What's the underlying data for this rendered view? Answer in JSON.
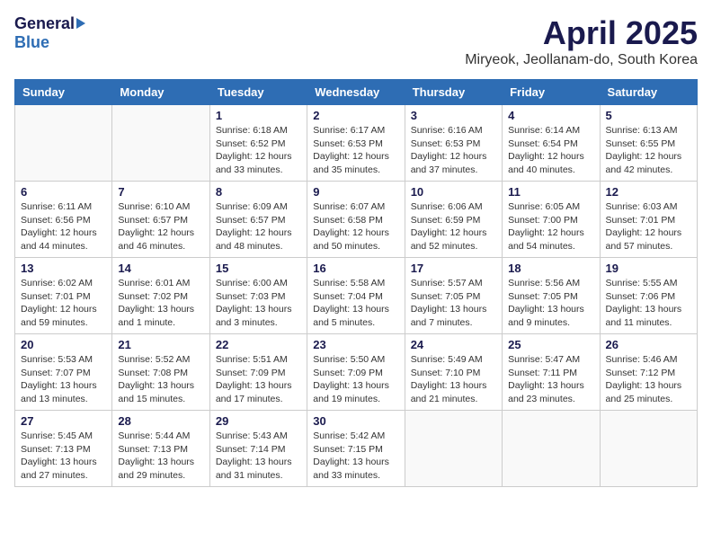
{
  "header": {
    "logo_general": "General",
    "logo_blue": "Blue",
    "title": "April 2025",
    "location": "Miryeok, Jeollanam-do, South Korea"
  },
  "days_of_week": [
    "Sunday",
    "Monday",
    "Tuesday",
    "Wednesday",
    "Thursday",
    "Friday",
    "Saturday"
  ],
  "weeks": [
    [
      {
        "day": "",
        "info": ""
      },
      {
        "day": "",
        "info": ""
      },
      {
        "day": "1",
        "info": "Sunrise: 6:18 AM\nSunset: 6:52 PM\nDaylight: 12 hours\nand 33 minutes."
      },
      {
        "day": "2",
        "info": "Sunrise: 6:17 AM\nSunset: 6:53 PM\nDaylight: 12 hours\nand 35 minutes."
      },
      {
        "day": "3",
        "info": "Sunrise: 6:16 AM\nSunset: 6:53 PM\nDaylight: 12 hours\nand 37 minutes."
      },
      {
        "day": "4",
        "info": "Sunrise: 6:14 AM\nSunset: 6:54 PM\nDaylight: 12 hours\nand 40 minutes."
      },
      {
        "day": "5",
        "info": "Sunrise: 6:13 AM\nSunset: 6:55 PM\nDaylight: 12 hours\nand 42 minutes."
      }
    ],
    [
      {
        "day": "6",
        "info": "Sunrise: 6:11 AM\nSunset: 6:56 PM\nDaylight: 12 hours\nand 44 minutes."
      },
      {
        "day": "7",
        "info": "Sunrise: 6:10 AM\nSunset: 6:57 PM\nDaylight: 12 hours\nand 46 minutes."
      },
      {
        "day": "8",
        "info": "Sunrise: 6:09 AM\nSunset: 6:57 PM\nDaylight: 12 hours\nand 48 minutes."
      },
      {
        "day": "9",
        "info": "Sunrise: 6:07 AM\nSunset: 6:58 PM\nDaylight: 12 hours\nand 50 minutes."
      },
      {
        "day": "10",
        "info": "Sunrise: 6:06 AM\nSunset: 6:59 PM\nDaylight: 12 hours\nand 52 minutes."
      },
      {
        "day": "11",
        "info": "Sunrise: 6:05 AM\nSunset: 7:00 PM\nDaylight: 12 hours\nand 54 minutes."
      },
      {
        "day": "12",
        "info": "Sunrise: 6:03 AM\nSunset: 7:01 PM\nDaylight: 12 hours\nand 57 minutes."
      }
    ],
    [
      {
        "day": "13",
        "info": "Sunrise: 6:02 AM\nSunset: 7:01 PM\nDaylight: 12 hours\nand 59 minutes."
      },
      {
        "day": "14",
        "info": "Sunrise: 6:01 AM\nSunset: 7:02 PM\nDaylight: 13 hours\nand 1 minute."
      },
      {
        "day": "15",
        "info": "Sunrise: 6:00 AM\nSunset: 7:03 PM\nDaylight: 13 hours\nand 3 minutes."
      },
      {
        "day": "16",
        "info": "Sunrise: 5:58 AM\nSunset: 7:04 PM\nDaylight: 13 hours\nand 5 minutes."
      },
      {
        "day": "17",
        "info": "Sunrise: 5:57 AM\nSunset: 7:05 PM\nDaylight: 13 hours\nand 7 minutes."
      },
      {
        "day": "18",
        "info": "Sunrise: 5:56 AM\nSunset: 7:05 PM\nDaylight: 13 hours\nand 9 minutes."
      },
      {
        "day": "19",
        "info": "Sunrise: 5:55 AM\nSunset: 7:06 PM\nDaylight: 13 hours\nand 11 minutes."
      }
    ],
    [
      {
        "day": "20",
        "info": "Sunrise: 5:53 AM\nSunset: 7:07 PM\nDaylight: 13 hours\nand 13 minutes."
      },
      {
        "day": "21",
        "info": "Sunrise: 5:52 AM\nSunset: 7:08 PM\nDaylight: 13 hours\nand 15 minutes."
      },
      {
        "day": "22",
        "info": "Sunrise: 5:51 AM\nSunset: 7:09 PM\nDaylight: 13 hours\nand 17 minutes."
      },
      {
        "day": "23",
        "info": "Sunrise: 5:50 AM\nSunset: 7:09 PM\nDaylight: 13 hours\nand 19 minutes."
      },
      {
        "day": "24",
        "info": "Sunrise: 5:49 AM\nSunset: 7:10 PM\nDaylight: 13 hours\nand 21 minutes."
      },
      {
        "day": "25",
        "info": "Sunrise: 5:47 AM\nSunset: 7:11 PM\nDaylight: 13 hours\nand 23 minutes."
      },
      {
        "day": "26",
        "info": "Sunrise: 5:46 AM\nSunset: 7:12 PM\nDaylight: 13 hours\nand 25 minutes."
      }
    ],
    [
      {
        "day": "27",
        "info": "Sunrise: 5:45 AM\nSunset: 7:13 PM\nDaylight: 13 hours\nand 27 minutes."
      },
      {
        "day": "28",
        "info": "Sunrise: 5:44 AM\nSunset: 7:13 PM\nDaylight: 13 hours\nand 29 minutes."
      },
      {
        "day": "29",
        "info": "Sunrise: 5:43 AM\nSunset: 7:14 PM\nDaylight: 13 hours\nand 31 minutes."
      },
      {
        "day": "30",
        "info": "Sunrise: 5:42 AM\nSunset: 7:15 PM\nDaylight: 13 hours\nand 33 minutes."
      },
      {
        "day": "",
        "info": ""
      },
      {
        "day": "",
        "info": ""
      },
      {
        "day": "",
        "info": ""
      }
    ]
  ]
}
